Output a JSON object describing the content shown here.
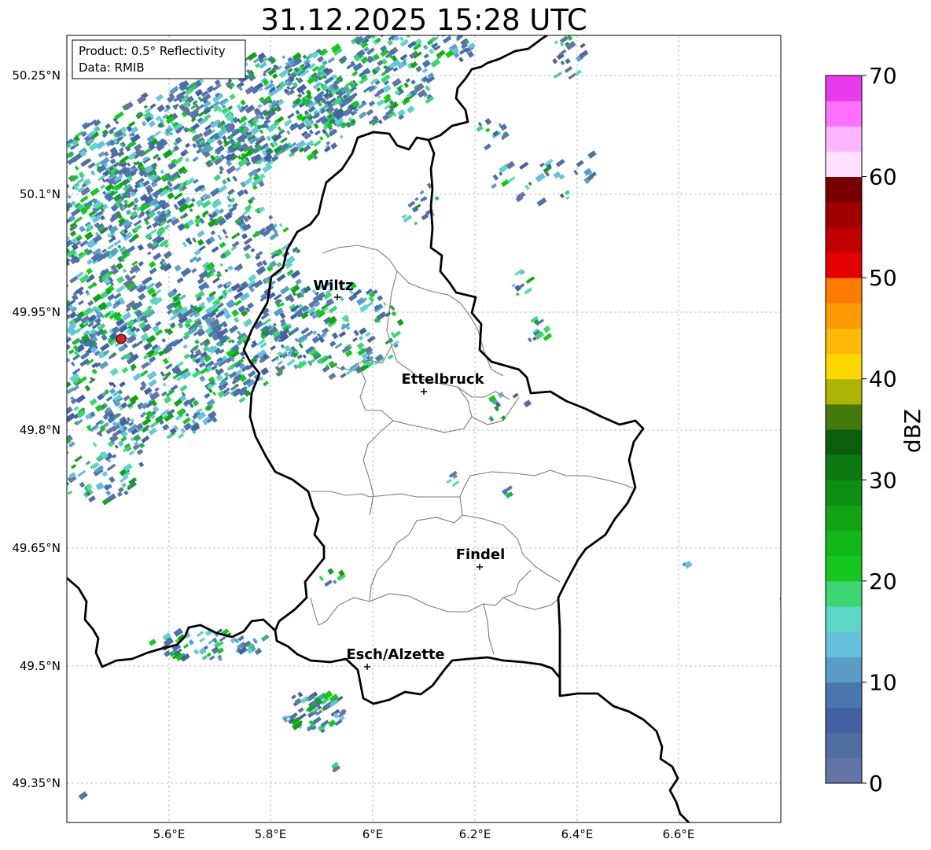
{
  "title": "31.12.2025 15:28 UTC",
  "info_box": {
    "line1": "Product: 0.5° Reflectivity",
    "line2": "Data: RMIB"
  },
  "axes": {
    "lat_labels": [
      "50.25°N",
      "50.1°N",
      "49.95°N",
      "49.8°N",
      "49.65°N",
      "49.5°N",
      "49.35°N"
    ],
    "lon_labels": [
      "5.6°E",
      "5.8°E",
      "6°E",
      "6.2°E",
      "6.4°E",
      "6.6°E"
    ]
  },
  "cities": [
    "Wiltz",
    "Ettelbruck",
    "Findel",
    "Esch/Alzette"
  ],
  "colorbar": {
    "label": "dBZ",
    "tick_labels": [
      "0",
      "10",
      "20",
      "30",
      "40",
      "50",
      "60",
      "70"
    ],
    "colors": [
      "#6574a8",
      "#516ea2",
      "#4460a0",
      "#4a76ac",
      "#5a9ec8",
      "#66c2dc",
      "#5ed6c6",
      "#3ed672",
      "#14c81e",
      "#12b818",
      "#10a414",
      "#0e8e12",
      "#0c7a10",
      "#0a5e0c",
      "#447a0c",
      "#aeb406",
      "#fed600",
      "#feb808",
      "#fe9a02",
      "#fe7a00",
      "#e20000",
      "#c00000",
      "#a00000",
      "#780000",
      "#ffe0ff",
      "#ffb6ff",
      "#ff70ff",
      "#e63aec"
    ],
    "range": [
      0,
      70
    ],
    "step": 2.5
  },
  "radar_site": {
    "marker": "red-circle"
  }
}
